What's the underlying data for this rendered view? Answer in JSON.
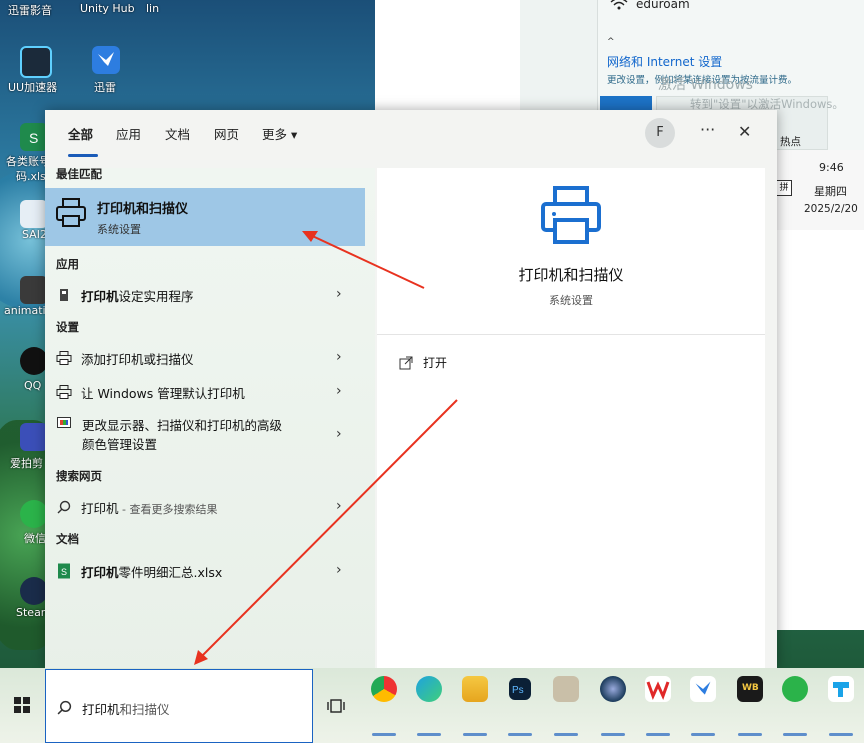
{
  "desktop": {
    "icons": [
      {
        "label": "迅雷影音"
      },
      {
        "label": "Unity Hub"
      },
      {
        "label": "UU加速器"
      },
      {
        "label": "迅雷"
      },
      {
        "label": "各类账号"
      },
      {
        "label": "码.xlsx"
      },
      {
        "label": "SAI2"
      },
      {
        "label": "animation"
      },
      {
        "label": "QQ"
      },
      {
        "label": "爱拍剪"
      },
      {
        "label": "微信"
      },
      {
        "label": "Steam"
      }
    ]
  },
  "network_panel": {
    "ssid": "eduroam",
    "settings_title": "网络和 Internet 设置",
    "settings_sub": "更改设置，例如将某连接设置为按流量计费。",
    "watermark_1": "激活 Windows",
    "watermark_2": "转到\"设置\"以激活Windows。",
    "hotspot_label": "热点"
  },
  "clock": {
    "time": "9:46",
    "day": "星期四",
    "date": "2025/2/20",
    "ime": "拼"
  },
  "search_panel": {
    "tabs": [
      {
        "label": "全部"
      },
      {
        "label": "应用"
      },
      {
        "label": "文档"
      },
      {
        "label": "网页"
      },
      {
        "label": "更多 ▾"
      }
    ],
    "avatar_letter": "F",
    "more_dots": "···",
    "close": "✕",
    "best_match_header": "最佳匹配",
    "best_match": {
      "title": "打印机和扫描仪",
      "sub": "系统设置"
    },
    "apps_header": "应用",
    "apps": [
      {
        "label_bold": "打印机",
        "label_rest": "设定实用程序"
      }
    ],
    "settings_header": "设置",
    "settings": [
      {
        "label": "添加打印机或扫描仪"
      },
      {
        "label": "让 Windows 管理默认打印机"
      },
      {
        "label_line1": "更改显示器、扫描仪和打印机的高级",
        "label_line2": "颜色管理设置"
      }
    ],
    "web_header": "搜索网页",
    "web": [
      {
        "label": "打印机",
        "suffix": " - 查看更多搜索结果"
      }
    ],
    "docs_header": "文档",
    "docs": [
      {
        "label_bold": "打印机",
        "label_rest": "零件明细汇总.xlsx"
      }
    ],
    "right": {
      "title": "打印机和扫描仪",
      "sub": "系统设置",
      "open_label": "打开"
    }
  },
  "taskbar": {
    "search_typed": "打印机",
    "search_hint": "和扫描仪",
    "wb_label": "WB"
  },
  "colors": {
    "accent": "#1a5bb8",
    "best_match_bg": "#9ec7e6",
    "printer_icon": "#1b6fd0"
  }
}
